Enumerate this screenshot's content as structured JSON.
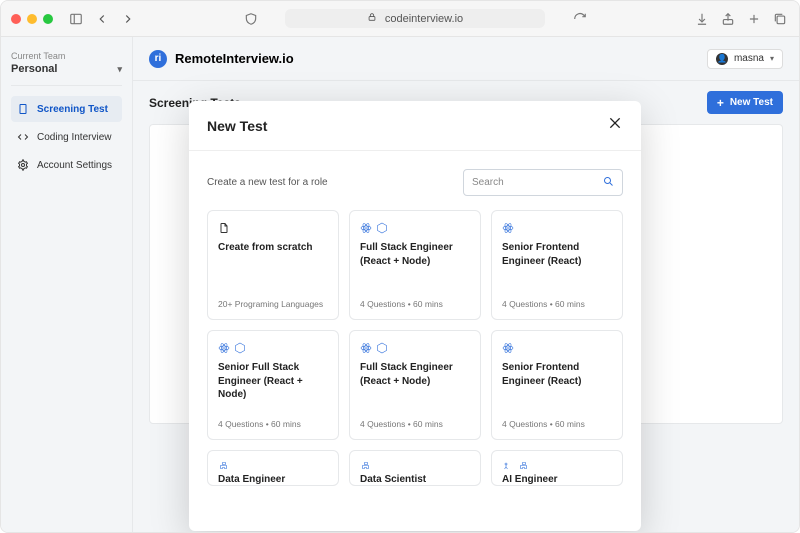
{
  "browser": {
    "url": "codeinterview.io"
  },
  "sidebar": {
    "team_label": "Current Team",
    "team_value": "Personal",
    "items": [
      {
        "label": "Screening Test"
      },
      {
        "label": "Coding Interview"
      },
      {
        "label": "Account Settings"
      }
    ]
  },
  "header": {
    "brand": "RemoteInterview.io",
    "user": "masna"
  },
  "page": {
    "title": "Screening Tests",
    "new_test_btn": "New Test"
  },
  "modal": {
    "title": "New Test",
    "subtitle": "Create a new test for a role",
    "search_placeholder": "Search",
    "cards": [
      {
        "title": "Create from scratch",
        "meta": "20+ Programing Languages"
      },
      {
        "title": "Full Stack Engineer (React + Node)",
        "meta": "4 Questions • 60 mins"
      },
      {
        "title": "Senior Frontend Engineer (React)",
        "meta": "4 Questions • 60 mins"
      },
      {
        "title": "Senior Full Stack Engineer (React + Node)",
        "meta": "4 Questions • 60 mins"
      },
      {
        "title": "Full Stack Engineer (React + Node)",
        "meta": "4 Questions • 60 mins"
      },
      {
        "title": "Senior Frontend Engineer (React)",
        "meta": "4 Questions • 60 mins"
      },
      {
        "title": "Data Engineer",
        "meta": ""
      },
      {
        "title": "Data Scientist",
        "meta": ""
      },
      {
        "title": "AI Engineer",
        "meta": ""
      }
    ]
  }
}
